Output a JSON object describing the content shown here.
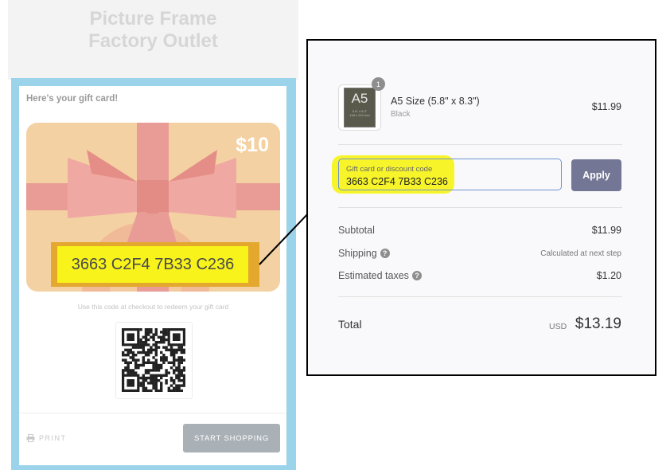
{
  "email": {
    "store_name_line1": "Picture Frame",
    "store_name_line2": "Factory Outlet",
    "heading": "Here's your gift card!",
    "card": {
      "amount": "$10",
      "code": "3663 C2F4 7B33 C236"
    },
    "use_note": "Use this code at checkout to redeem your gift card",
    "print_label": "PRINT",
    "start_shopping_label": "START SHOPPING"
  },
  "checkout": {
    "item": {
      "quantity": "1",
      "thumb_text": "A5",
      "thumb_sub1": "5.8\" x 8.3\"",
      "thumb_sub2": "148 x 210 mm",
      "title": "A5 Size (5.8\" x 8.3\")",
      "variant": "Black",
      "price": "$11.99"
    },
    "gift_card_field": {
      "label": "Gift card or discount code",
      "value": "3663 C2F4 7B33 C236"
    },
    "apply_label": "Apply",
    "rows": [
      {
        "label": "Subtotal",
        "value": "$11.99"
      },
      {
        "label": "Shipping",
        "value": "Calculated at next step"
      },
      {
        "label": "Estimated taxes",
        "value": "$1.20"
      }
    ],
    "total": {
      "label": "Total",
      "currency": "USD",
      "amount": "$13.19"
    }
  },
  "colors": {
    "frame_blue": "#9ad3ea",
    "highlight_yellow": "#f7f52a",
    "card_peach": "#f3d1a2",
    "ribbon_pink": "#e99b95",
    "apply_button": "#737795"
  },
  "icons": [
    "help-icon",
    "printer-icon",
    "qr-code"
  ]
}
